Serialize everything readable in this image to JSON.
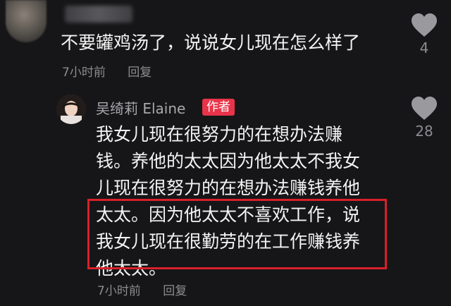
{
  "comment": {
    "text": "不要罐鸡汤了，说说女儿现在怎么样了",
    "time": "7小时前",
    "reply_label": "回复",
    "likes": "4"
  },
  "reply": {
    "author": "吴绮莉 Elaine",
    "badge": "作者",
    "lines": [
      "我女儿现在很努力的在想办法赚",
      "钱。养他的太太因为他太太不我女",
      "儿现在很努力的在想办法赚钱养他",
      "太太。因为他太太不喜欢工作，说",
      "我女儿现在很勤劳的在工作赚钱养",
      "他太太。"
    ],
    "time": "7小时前",
    "reply_label": "回复",
    "likes": "28"
  },
  "colors": {
    "background": "#161618",
    "badge": "#e8344a",
    "highlight_border": "#d9202a",
    "meta_text": "#8c8c90"
  }
}
